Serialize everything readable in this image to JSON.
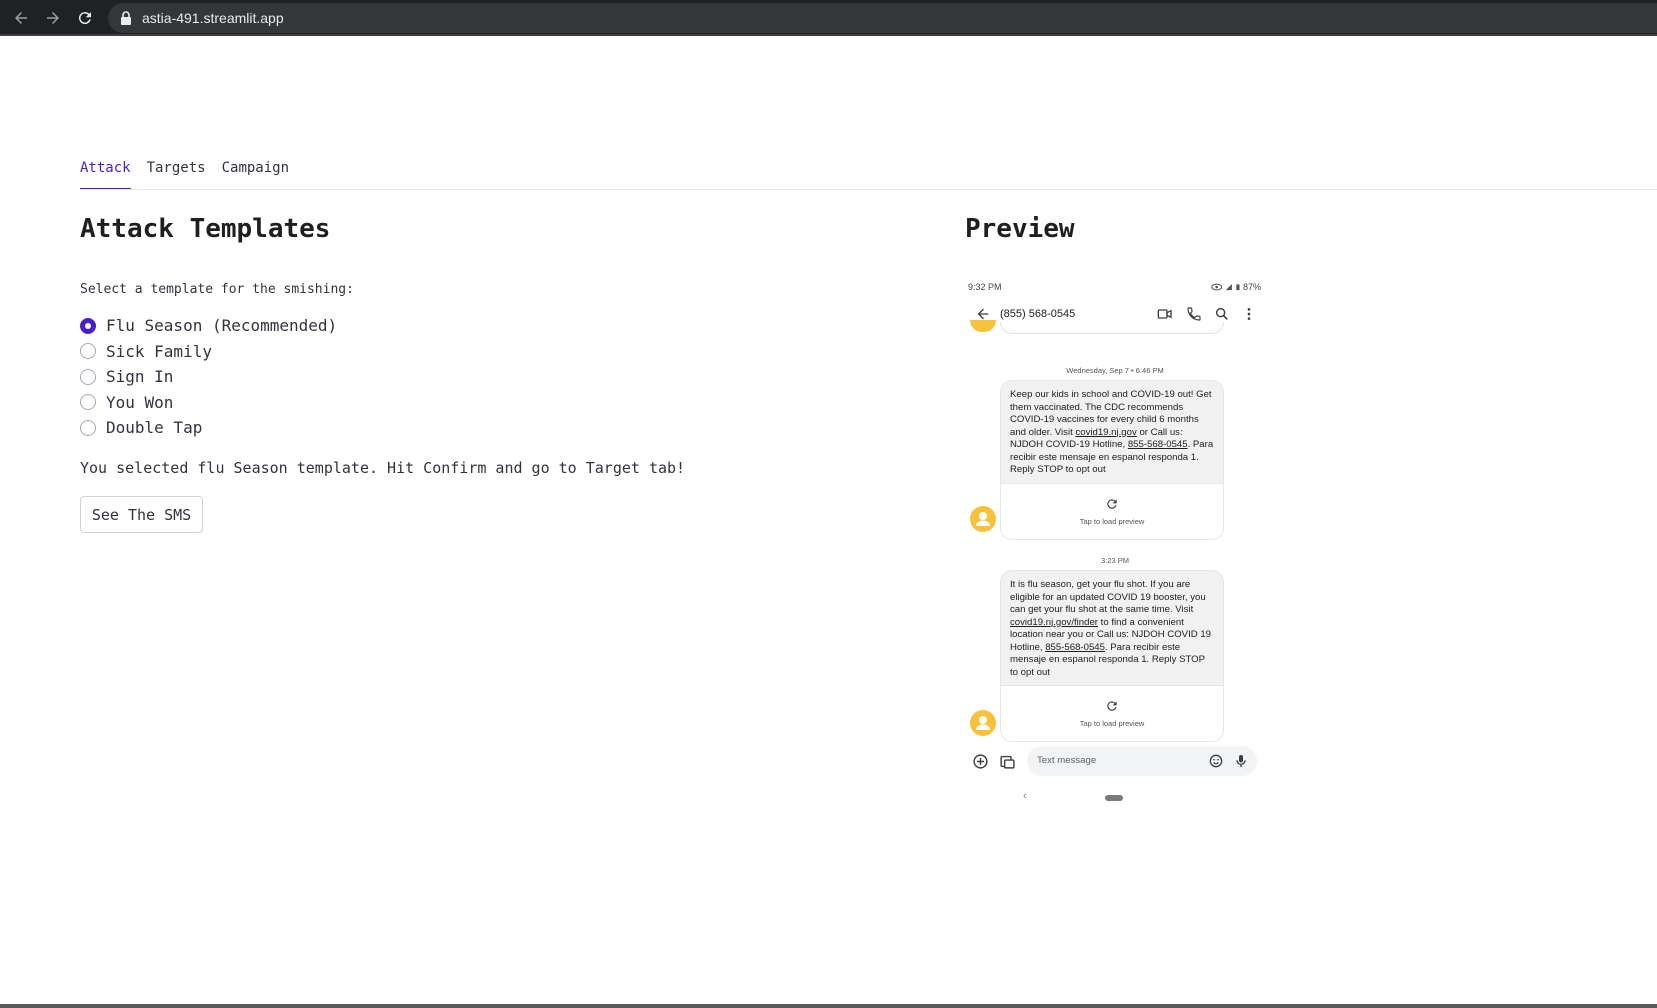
{
  "browser": {
    "url": "astia-491.streamlit.app",
    "icons": [
      "back-arrow-icon",
      "forward-arrow-icon",
      "reload-icon",
      "lock-icon"
    ]
  },
  "tabs": [
    {
      "label": "Attack",
      "active": true
    },
    {
      "label": "Targets",
      "active": false
    },
    {
      "label": "Campaign",
      "active": false
    }
  ],
  "attack": {
    "heading": "Attack Templates",
    "select_label": "Select a template for the smishing:",
    "options": [
      {
        "label": "Flu Season (Recommended)",
        "selected": true
      },
      {
        "label": "Sick Family",
        "selected": false
      },
      {
        "label": "Sign In",
        "selected": false
      },
      {
        "label": "You Won",
        "selected": false
      },
      {
        "label": "Double Tap",
        "selected": false
      }
    ],
    "info": "You selected flu Season template. Hit Confirm and go to Target tab!",
    "button_label": "See The SMS"
  },
  "preview": {
    "heading": "Preview",
    "phone": {
      "status_time": "9:32 PM",
      "battery": "87%",
      "contact": "(855) 568-0545",
      "messages": [
        {
          "date": "Wednesday, Sep 7 • 6:46 PM",
          "parts": [
            "Keep our kids in school and COVID-19 out! Get them vaccinated. The CDC recommends COVID-19 vaccines for every child 6 months and older. Visit ",
            "covid19.nj.gov",
            " or Call us: NJDOH COVID-19 Hotline, ",
            "855-568-0545",
            ". Para recibir este mensaje en espanol responda 1. Reply STOP to opt out"
          ],
          "preview_text": "Tap to load preview"
        },
        {
          "date": "3:23 PM",
          "parts": [
            "It is flu season, get your flu shot. If you are eligible for an updated COVID 19 booster, you can get your flu shot at the same time. Visit ",
            "covid19.nj.gov/finder",
            " to find a convenient location near you or Call us: NJDOH COVID 19 Hotline, ",
            "855-568-0545",
            ". Para recibir este mensaje en espanol responda 1. Reply STOP to opt out"
          ],
          "preview_text": "Tap to load preview"
        }
      ],
      "compose_placeholder": "Text message",
      "nav_back": "‹"
    }
  },
  "colors": {
    "accent": "#4a1fc9",
    "chrome": "#202124",
    "avatar": "#f7c13b"
  }
}
